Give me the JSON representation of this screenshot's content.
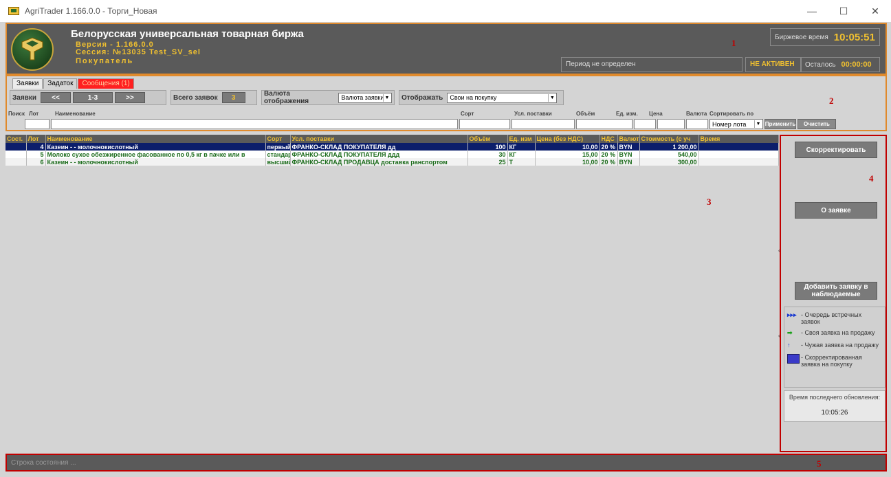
{
  "window": {
    "title": "AgriTrader 1.166.0.0 - Торги_Новая",
    "minimize": "—",
    "maximize": "☐",
    "close": "✕"
  },
  "header": {
    "exchange_name": "Белорусская универсальная товарная биржа",
    "version": "Версия - 1.166.0.0",
    "session": "Сессия: №13035 Test_SV_sel",
    "role": "Покупатель",
    "exchange_time_label": "Биржевое время",
    "exchange_time": "10:05:51",
    "period": "Период не определен",
    "status": "НЕ АКТИВЕН",
    "remaining_label": "Осталось",
    "remaining": "00:00:00"
  },
  "regions": [
    "1",
    "2",
    "3",
    "4",
    "5"
  ],
  "tabs": [
    {
      "label": "Заявки"
    },
    {
      "label": "Задаток"
    },
    {
      "label": "Сообщения (1)"
    }
  ],
  "controls": {
    "orders_label": "Заявки",
    "prev": "<<",
    "range": "1-3",
    "next": ">>",
    "total_label": "Всего заявок",
    "total": "3",
    "currency_label": "Валюта отображения",
    "currency_value": "Валюта заявки",
    "display_label": "Отображать",
    "display_value": "Свои на покупку"
  },
  "search": {
    "search": "Поиск",
    "lot": "Лот",
    "name": "Наименование",
    "grade": "Сорт",
    "delivery": "Усл. поставки",
    "volume": "Объём",
    "unit": "Ед. изм.",
    "price": "Цена",
    "currency": "Валюта",
    "sort_by": "Сортировать по",
    "sort_value": "Номер лота",
    "apply": "Применить",
    "clear": "Очистить"
  },
  "table": {
    "headers": [
      "Сост.",
      "Лот",
      "Наименование",
      "Сорт",
      "Усл. поставки",
      "Объём",
      "Ед. изм",
      "Цена (без НДС)",
      "НДС",
      "Валюта",
      "Стоимость (с уч",
      "Время"
    ],
    "rows": [
      [
        "",
        "4",
        "Казеин - - молочнокислотный",
        "первый",
        "ФРАНКО-СКЛАД ПОКУПАТЕЛЯ дд",
        "100",
        "КГ",
        "10,00",
        "20 %",
        "BYN",
        "1 200,00",
        ""
      ],
      [
        "",
        "5",
        "Молоко сухое обезжиренное фасованное по 0,5 кг в пачке или в",
        "стандар",
        "ФРАНКО-СКЛАД ПОКУПАТЕЛЯ ддд",
        "30",
        "КГ",
        "15,00",
        "20 %",
        "BYN",
        "540,00",
        ""
      ],
      [
        "",
        "6",
        "Казеин - - молочнокислотный",
        "высший",
        "ФРАНКО-СКЛАД ПРОДАВЦА доставка ранспортом",
        "25",
        "Т",
        "10,00",
        "20 %",
        "BYN",
        "300,00",
        ""
      ]
    ]
  },
  "right_panel": {
    "correct": "Скорректировать",
    "about": "О заявке",
    "watch": "Добавить заявку в наблюдаемые",
    "legend": [
      {
        "icon": "▸▸▸",
        "text": "- Очередь встречных заявок"
      },
      {
        "icon": "➡",
        "text": "- Своя заявка на продажу"
      },
      {
        "icon": "↑",
        "text": "- Чужая заявка на продажу"
      },
      {
        "icon": "",
        "text": "- Скорректированная заявка на покупку"
      }
    ],
    "last_update_label": "Время последнего обновления:",
    "last_update": "10:05:26"
  },
  "status_bar": {
    "text": "Строка состояния ..."
  },
  "colors": {
    "accent_gold": "#f0c030",
    "header_bg": "#5a5a5a",
    "selected_row": "#0c1e6b",
    "row_text": "#1a6b1a",
    "region_border": "#c00000",
    "orange_border": "#e08a2c"
  }
}
